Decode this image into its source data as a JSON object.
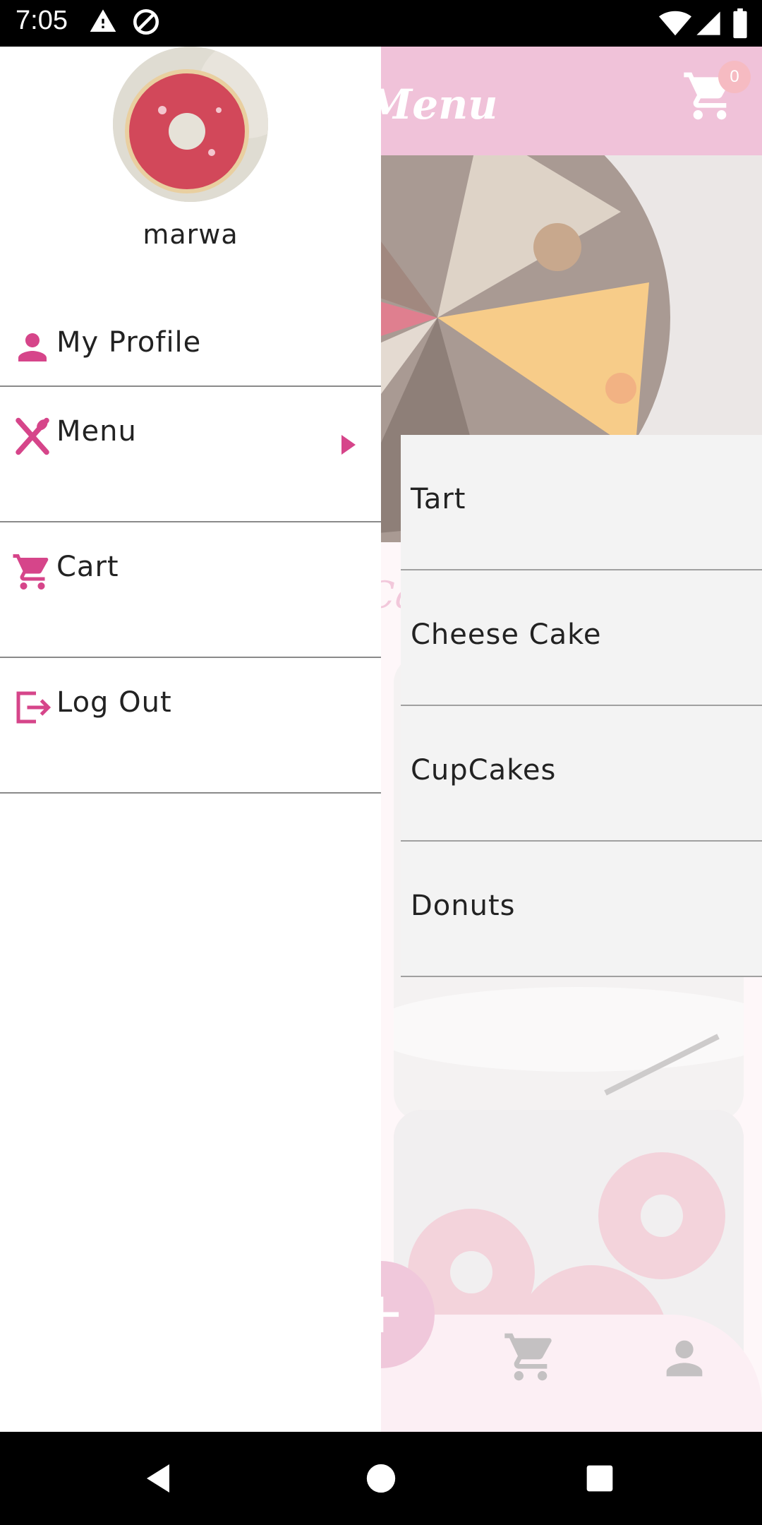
{
  "status_bar": {
    "time": "7:05"
  },
  "app_bar": {
    "title": "Menu",
    "cart_count": "0"
  },
  "section": {
    "title": "Ca"
  },
  "drawer": {
    "username": "marwa",
    "items": [
      {
        "label": "My Profile",
        "icon": "person-icon"
      },
      {
        "label": "Menu",
        "icon": "utensils-icon"
      },
      {
        "label": "Cart",
        "icon": "cart-icon"
      },
      {
        "label": "Log Out",
        "icon": "logout-icon"
      }
    ]
  },
  "submenu": {
    "items": [
      "Tart",
      "Cheese Cake",
      "CupCakes",
      "Donuts"
    ]
  },
  "colors": {
    "accent": "#d6458a",
    "app_bar": "#e697be",
    "drawer_bg": "#ffffff",
    "submenu_bg": "#f3f3f3"
  }
}
